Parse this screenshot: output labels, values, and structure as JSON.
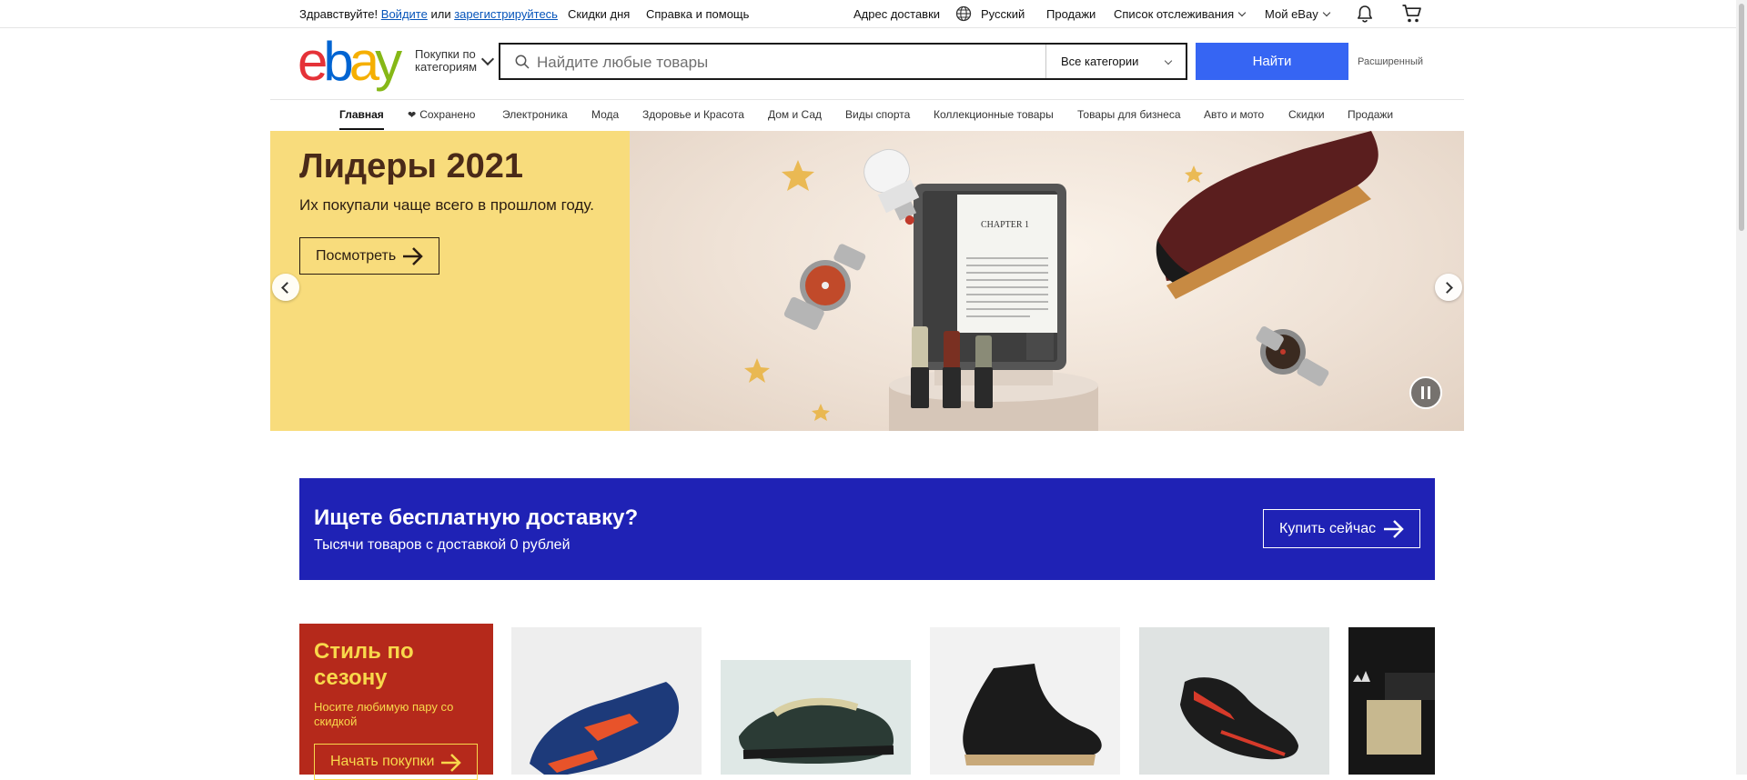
{
  "topbar": {
    "greeting": "Здравствуйте!",
    "signin_label": "Войдите",
    "or_label": "или",
    "register_label": "зарегистрируйтесь",
    "daily_deals": "Скидки дня",
    "help": "Справка и помощь",
    "ship_to": "Адрес доставки",
    "language": "Русский",
    "sell": "Продажи",
    "watchlist": "Список отслеживания",
    "my_ebay": "Мой eBay"
  },
  "header": {
    "logo_letters": [
      "e",
      "b",
      "a",
      "y"
    ],
    "logo_colors": [
      "#e53238",
      "#0064d2",
      "#f5af02",
      "#86b817"
    ],
    "shop_by_category": "Покупки по категориям",
    "search_placeholder": "Найдите любые товары",
    "category_select": "Все категории",
    "search_button": "Найти",
    "advanced": "Расширенный"
  },
  "nav": {
    "tabs": [
      "Главная",
      "Сохранено",
      "Электроника",
      "Мода",
      "Здоровье и Красота",
      "Дом и Сад",
      "Виды спорта",
      "Коллекционные товары",
      "Товары для бизнеса",
      "Авто и мото",
      "Скидки",
      "Продажи"
    ]
  },
  "hero": {
    "title": "Лидеры 2021",
    "subtitle": "Их покупали чаще всего в прошлом году.",
    "button": "Посмотреть",
    "book_heading": "CHAPTER 1",
    "bg_color": "#f8dc7c"
  },
  "shipping": {
    "title": "Ищете бесплатную доставку?",
    "subtitle": "Тысячи товаров с доставкой 0 рублей",
    "button": "Купить сейчас",
    "bg_color": "#1f22b5"
  },
  "season": {
    "title": "Стиль по сезону",
    "subtitle": "Носите любимую пару со скидкой",
    "button": "Начать покупки",
    "bg_color": "#b5291b"
  },
  "accent": {
    "primary_blue": "#3665f3",
    "link_blue": "#0654ba"
  }
}
